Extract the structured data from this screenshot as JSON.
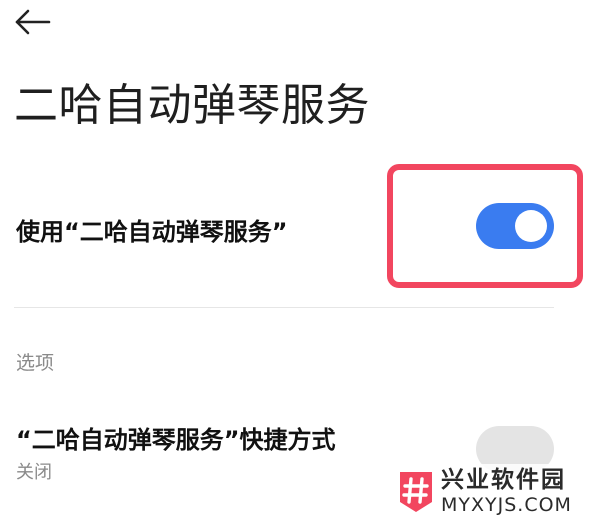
{
  "header": {
    "back_icon": "arrow-left-icon",
    "title": "二哈自动弹琴服务"
  },
  "main_setting": {
    "label": "使用“二哈自动弹琴服务”",
    "toggle_state": "on",
    "toggle_color": "#3a7cf0",
    "highlight_color": "#f2465f"
  },
  "options": {
    "header": "选项",
    "shortcut": {
      "label": "“二哈自动弹琴服务”快捷方式",
      "status": "关闭",
      "toggle_state": "off"
    }
  },
  "watermark": {
    "logo_icon": "hash-logo",
    "name": "兴业软件园",
    "domain": "MYXYJS.COM"
  }
}
